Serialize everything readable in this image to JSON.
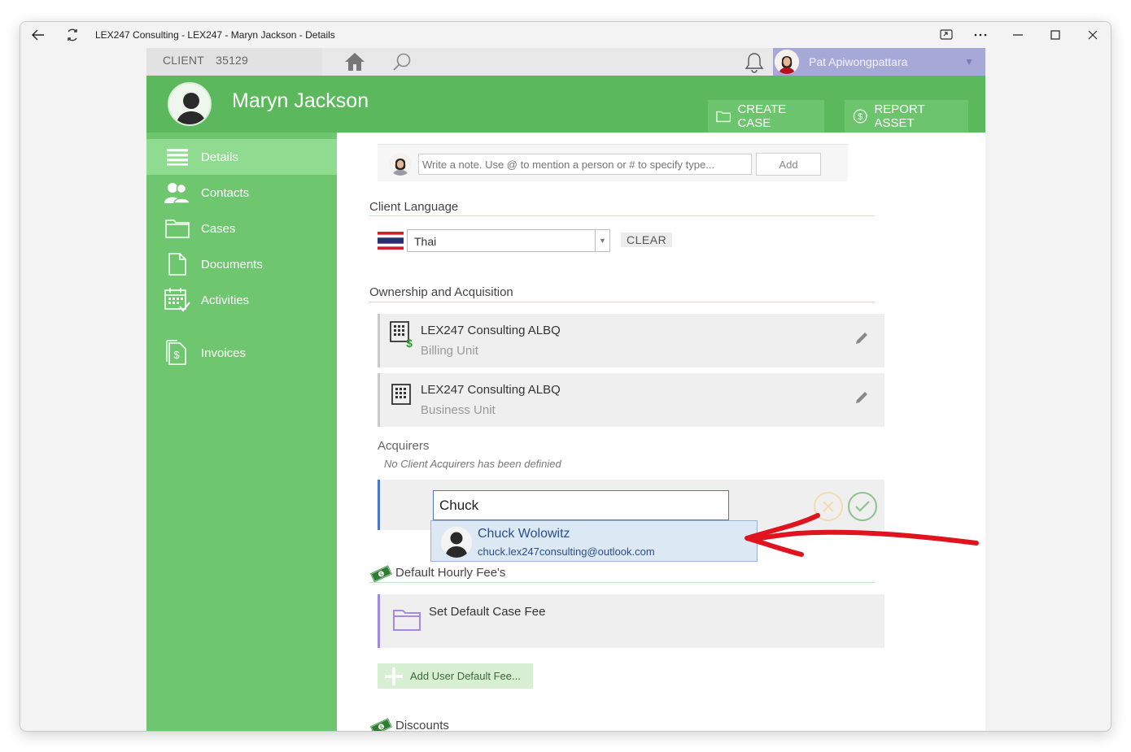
{
  "window": {
    "title": "LEX247 Consulting - LEX247 - Maryn Jackson - Details"
  },
  "topbar": {
    "client_label": "CLIENT",
    "client_id": "35129",
    "user_name": "Pat Apiwongpattara"
  },
  "header": {
    "name": "Maryn Jackson",
    "create_case": "CREATE CASE",
    "report_asset": "REPORT ASSET"
  },
  "sidebar": {
    "items": [
      {
        "label": "Details",
        "icon": "list-icon"
      },
      {
        "label": "Contacts",
        "icon": "contacts-icon"
      },
      {
        "label": "Cases",
        "icon": "folder-icon"
      },
      {
        "label": "Documents",
        "icon": "document-icon"
      },
      {
        "label": "Activities",
        "icon": "calendar-icon"
      },
      {
        "label": "Invoices",
        "icon": "invoice-icon"
      }
    ]
  },
  "note": {
    "placeholder": "Write a note. Use @ to mention a person or # to specify type...",
    "add_label": "Add"
  },
  "language": {
    "title": "Client Language",
    "value": "Thai",
    "clear_label": "CLEAR"
  },
  "ownership": {
    "title": "Ownership and Acquisition",
    "units": [
      {
        "name": "LEX247 Consulting ALBQ",
        "type": "Billing Unit"
      },
      {
        "name": "LEX247 Consulting ALBQ",
        "type": "Business Unit"
      }
    ]
  },
  "acquirers": {
    "title": "Acquirers",
    "empty_text": "No Client Acquirers has been definied",
    "input_value": "Chuck",
    "suggestion": {
      "name": "Chuck Wolowitz",
      "email": "chuck.lex247consulting@outlook.com"
    }
  },
  "fees": {
    "title": "Default Hourly Fee's",
    "case_fee_label": "Set Default Case Fee",
    "add_label": "Add User Default Fee..."
  },
  "discounts": {
    "title": "Discounts"
  },
  "colors": {
    "brand_green": "#5cb85c",
    "sidebar_green": "#6ec76e",
    "active_nav": "#8fdb8f",
    "user_chip": "#a6a9d7",
    "annotation_red": "#e0141e"
  }
}
